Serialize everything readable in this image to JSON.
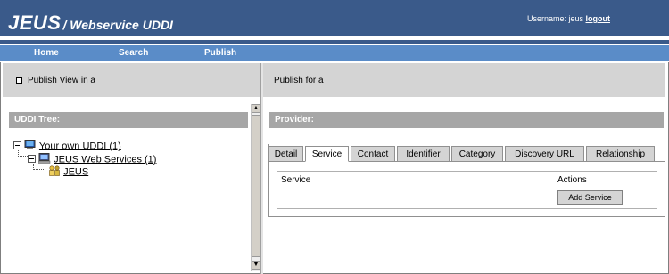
{
  "header": {
    "logo": "JEUS",
    "subtitle": "/ Webservice UDDI",
    "username_label": "Username: jeus",
    "logout": "logout"
  },
  "nav": {
    "items": [
      "Home",
      "Search",
      "Publish"
    ]
  },
  "left": {
    "banner": "Publish View in a",
    "tree_title": "UDDI Tree:",
    "tree": [
      {
        "label": "Your own UDDI (1)",
        "icon": "computer-icon"
      },
      {
        "label": "JEUS Web Services (1)",
        "icon": "server-icon"
      },
      {
        "label": "JEUS",
        "icon": "people-icon"
      }
    ]
  },
  "right": {
    "banner": "Publish for a",
    "provider_title": "Provider:",
    "tabs": [
      "Detail",
      "Service",
      "Contact",
      "Identifier",
      "Category",
      "Discovery URL",
      "Relationship"
    ],
    "active_tab": "Service",
    "table": {
      "col1": "Service",
      "col2": "Actions",
      "button": "Add Service"
    }
  }
}
